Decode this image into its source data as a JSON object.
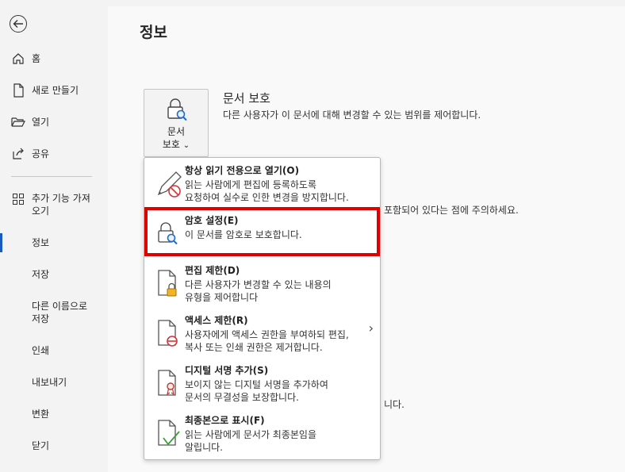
{
  "sidebar": {
    "back_icon": "arrow-left-icon",
    "items": [
      {
        "label": "홈",
        "icon": "home-icon"
      },
      {
        "label": "새로 만들기",
        "icon": "new-document-icon"
      },
      {
        "label": "열기",
        "icon": "folder-open-icon"
      },
      {
        "label": "공유",
        "icon": "share-icon"
      },
      {
        "label": "추가 기능 가져",
        "label2": "오기",
        "icon": "addins-icon"
      },
      {
        "label": "정보"
      },
      {
        "label": "저장"
      },
      {
        "label": "다른 이름으로",
        "label2": "저장"
      },
      {
        "label": "인쇄"
      },
      {
        "label": "내보내기"
      },
      {
        "label": "변환"
      },
      {
        "label": "닫기"
      }
    ]
  },
  "main": {
    "title": "정보",
    "protect_button": {
      "line1": "문서",
      "line2": "보호",
      "chevron": "⌄"
    },
    "section_title": "문서 보호",
    "section_desc": "다른 사용자가 이 문서에 대해 변경할 수 있는 범위를 제어합니다.",
    "bg_text_1": "포함되어 있다는 점에 주의하세요.",
    "bg_text_2": "니다."
  },
  "menu": {
    "items": [
      {
        "title": "항상 읽기 전용으로 열기(O)",
        "desc1": "읽는 사람에게 편집에 등록하도록",
        "desc2": "요청하여 실수로 인한 변경을 방지합니다.",
        "icon": "pencil-no-icon"
      },
      {
        "title": "암호 설정(E)",
        "desc1": "이 문서를 암호로 보호합니다.",
        "desc2": "",
        "icon": "lock-key-icon"
      },
      {
        "title": "편집 제한(D)",
        "desc1": "다른 사용자가 변경할 수 있는 내용의",
        "desc2": "유형을 제어합니다",
        "icon": "document-lock-icon"
      },
      {
        "title": "액세스 제한(R)",
        "desc1": "사용자에게 액세스 권한을 부여하되 편집,",
        "desc2": "복사 또는 인쇄 권한은 제거합니다.",
        "icon": "document-restrict-icon",
        "chevron": "›"
      },
      {
        "title": "디지털 서명 추가(S)",
        "desc1": "보이지 않는 디지털 서명을 추가하여",
        "desc2": "문서의 무결성을 보장합니다.",
        "icon": "document-ribbon-icon"
      },
      {
        "title": "최종본으로 표시(F)",
        "desc1": "읽는 사람에게 문서가 최종본임을",
        "desc2": "알립니다.",
        "icon": "document-check-icon"
      }
    ]
  },
  "colors": {
    "accent": "#185abd",
    "highlight": "#e00000"
  }
}
